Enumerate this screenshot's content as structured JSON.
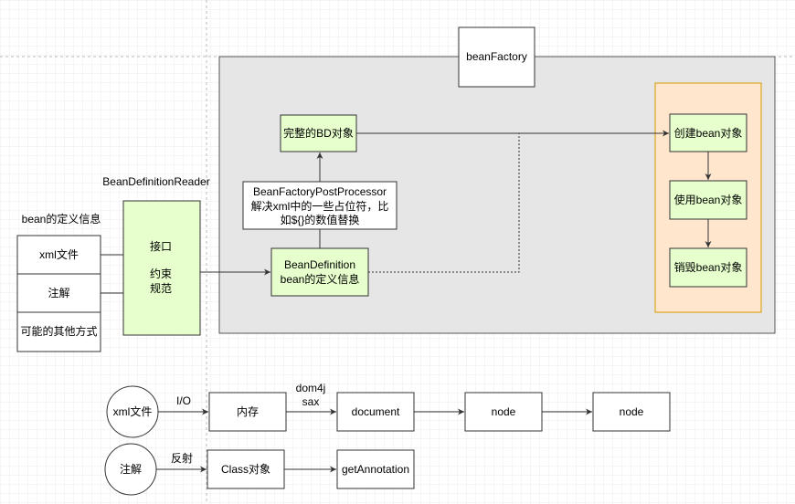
{
  "colors": {
    "green_fill": "#e6ffcc",
    "orange_fill": "#ffe6cc",
    "orange_stroke": "#d79b00",
    "container_fill": "#e6e6e6"
  },
  "bean_factory": {
    "title": "beanFactory"
  },
  "complete_bd": "完整的BD对象",
  "post_processor": {
    "line1": "BeanFactoryPostProcessor",
    "line2": "解决xml中的一些占位符，比",
    "line3": "如${}的数值替换"
  },
  "bean_definition": {
    "line1": "BeanDefinition",
    "line2": "bean的定义信息"
  },
  "lifecycle": [
    "创建bean对象",
    "使用bean对象",
    "销毁bean对象"
  ],
  "reader": {
    "title": "BeanDefinitionReader",
    "line1": "接口",
    "line2": "约束",
    "line3": "规范"
  },
  "sources": {
    "title": "bean的定义信息",
    "rows": [
      "xml文件",
      "注解",
      "可能的其他方式"
    ]
  },
  "xml_flow": {
    "start": "xml文件",
    "edge1": "I/O",
    "step1": "内存",
    "edge2a": "dom4j",
    "edge2b": "sax",
    "step2": "document",
    "step3": "node",
    "step4": "node"
  },
  "annotation_flow": {
    "start": "注解",
    "edge1": "反射",
    "step1": "Class对象",
    "step2": "getAnnotation"
  }
}
